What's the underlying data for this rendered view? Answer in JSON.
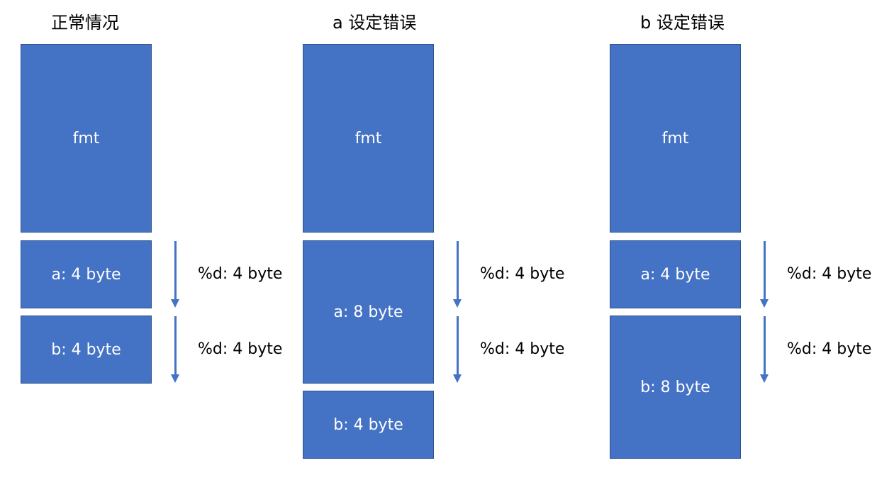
{
  "columns": [
    {
      "title": "正常情况",
      "blocks": [
        {
          "label": "fmt"
        },
        {
          "label": "a: 4 byte"
        },
        {
          "label": "b: 4 byte"
        }
      ],
      "notes": [
        {
          "label": "%d: 4 byte"
        },
        {
          "label": "%d: 4 byte"
        }
      ]
    },
    {
      "title": "a 设定错误",
      "blocks": [
        {
          "label": "fmt"
        },
        {
          "label": "a: 8 byte"
        },
        {
          "label": "b: 4 byte"
        }
      ],
      "notes": [
        {
          "label": "%d: 4 byte"
        },
        {
          "label": "%d: 4 byte"
        }
      ]
    },
    {
      "title": "b 设定错误",
      "blocks": [
        {
          "label": "fmt"
        },
        {
          "label": "a: 4 byte"
        },
        {
          "label": "b: 8 byte"
        }
      ],
      "notes": [
        {
          "label": "%d: 4 byte"
        },
        {
          "label": "%d: 4 byte"
        }
      ]
    }
  ],
  "colors": {
    "block_fill": "#4472c4",
    "block_border": "#2f528f",
    "block_text": "#ffffff",
    "arrow": "#4472c4"
  }
}
